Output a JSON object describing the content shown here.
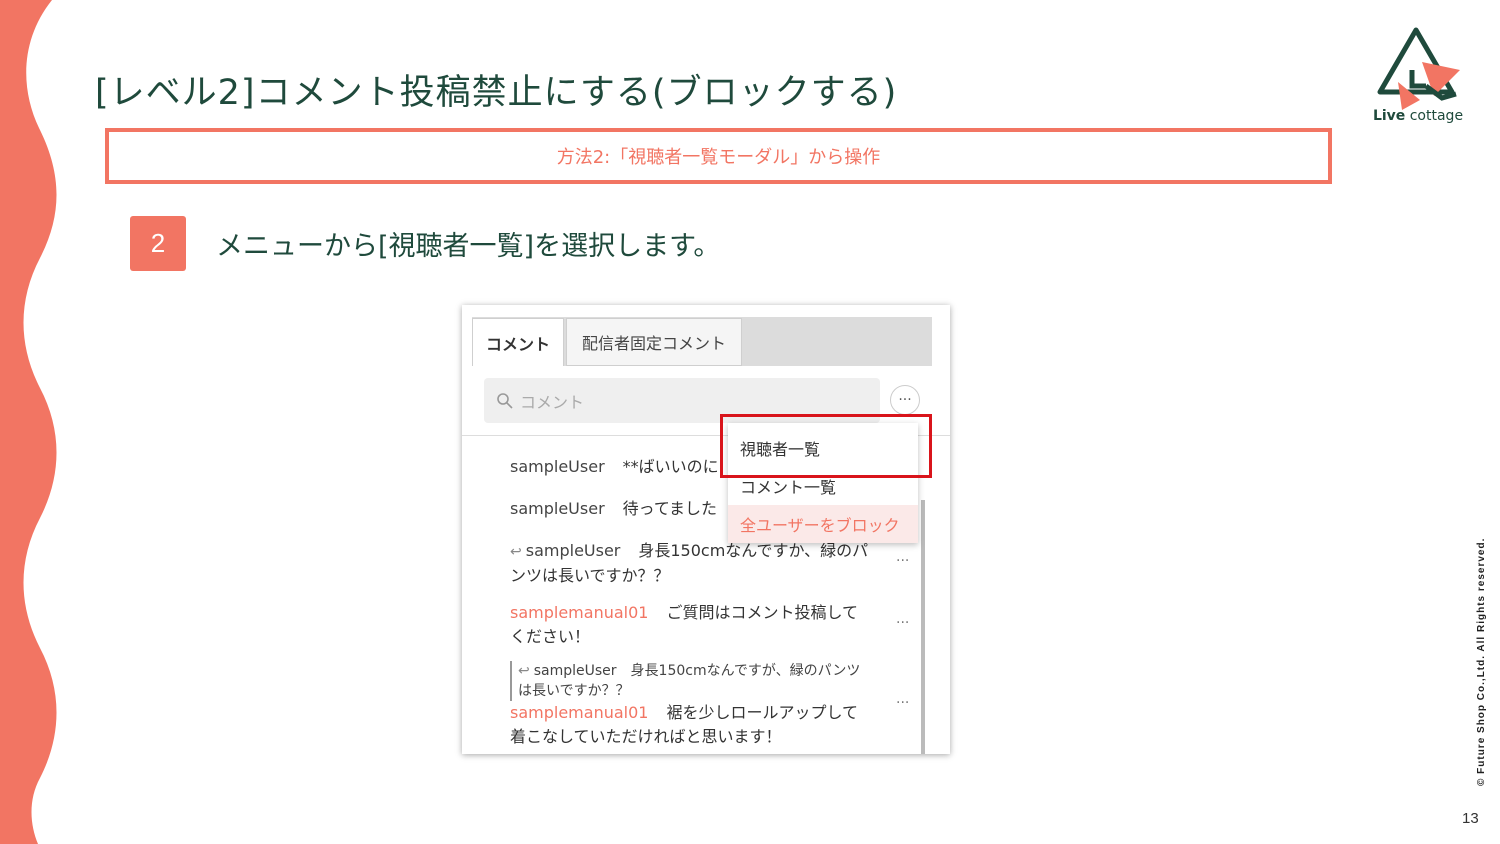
{
  "slide": {
    "title": "[レベル2]コメント投稿禁止にする(ブロックする)",
    "method_label": "方法2:「視聴者一覧モーダル」から操作",
    "step_number": "2",
    "step_text": "メニューから[視聴者一覧]を選択します。",
    "copyright": "© Future Shop Co.,Ltd. All Rights reserved.",
    "page_number": "13",
    "accent_color": "#f27563",
    "heading_color": "#1f4a3c"
  },
  "logo": {
    "word_bold": "Live",
    "word_light": " cottage"
  },
  "panel": {
    "tabs": [
      {
        "label": "コメント",
        "active": true
      },
      {
        "label": "配信者固定コメント",
        "active": false
      }
    ],
    "search_placeholder": "コメント",
    "more_label": "···",
    "menu": [
      {
        "label": "視聴者一覧",
        "highlighted": true
      },
      {
        "label": "コメント一覧"
      },
      {
        "label": "全ユーザーをブロック",
        "danger": true
      }
    ],
    "comments": [
      {
        "user": "sampleUser",
        "text": "**ばいいのに"
      },
      {
        "user": "sampleUser",
        "text": "待ってました"
      },
      {
        "user": "sampleUser",
        "reply": true,
        "text_line1": "身長150cmなんですか、緑のパ",
        "text_line2": "ンツは長いですか？？"
      },
      {
        "user": "samplemanual01",
        "admin": true,
        "text_line1": "ご質問はコメント投稿して",
        "text_line2": "ください！"
      },
      {
        "quote_user": "sampleUser",
        "quote_line1": "身長150cmなんですが、緑のパンツ",
        "quote_line2": "は長いですか？？",
        "user": "samplemanual01",
        "admin": true,
        "text_line1": "裾を少しロールアップして",
        "text_line2": "着こなしていただければと思います！"
      }
    ]
  }
}
